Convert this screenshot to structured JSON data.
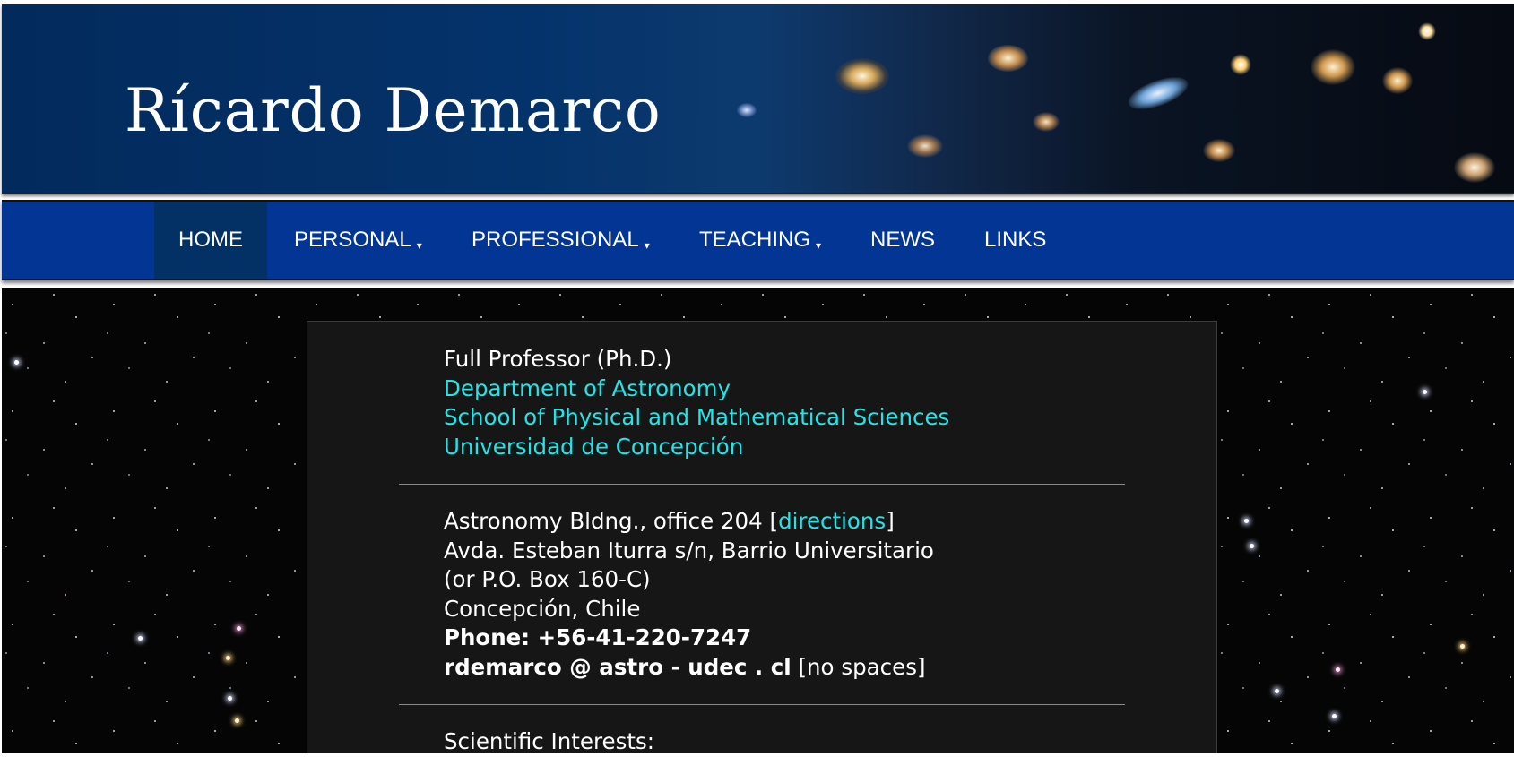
{
  "banner": {
    "title": "Rícardo Demarco"
  },
  "nav": {
    "items": [
      {
        "label": "HOME",
        "active": true,
        "dropdown": false
      },
      {
        "label": "PERSONAL",
        "active": false,
        "dropdown": true
      },
      {
        "label": "PROFESSIONAL",
        "active": false,
        "dropdown": true
      },
      {
        "label": "TEACHING",
        "active": false,
        "dropdown": true
      },
      {
        "label": "NEWS",
        "active": false,
        "dropdown": false
      },
      {
        "label": "LINKS",
        "active": false,
        "dropdown": false
      }
    ],
    "caret": "▾"
  },
  "affiliation": {
    "position": "Full Professor (Ph.D.)",
    "department": "Department of Astronomy",
    "school": "School of Physical and Mathematical Sciences",
    "university": "Universidad de Concepción"
  },
  "contact": {
    "office_prefix": "Astronomy Bldng., office 204 [",
    "directions_link": "directions",
    "office_suffix": "]",
    "street": "Avda. Esteban Iturra s/n, Barrio Universitario",
    "po_box": "(or P.O. Box 160-C)",
    "city": "Concepción, Chile",
    "phone": "Phone: +56-41-220-7247",
    "email": "rdemarco @ astro - udec . cl",
    "email_note": " [no spaces]"
  },
  "interests": {
    "heading": "Scientific Interests:"
  },
  "colors": {
    "nav_bg": "#033594",
    "nav_active_bg": "#033166",
    "link": "#27e3e6",
    "panel_bg": "#161616"
  }
}
